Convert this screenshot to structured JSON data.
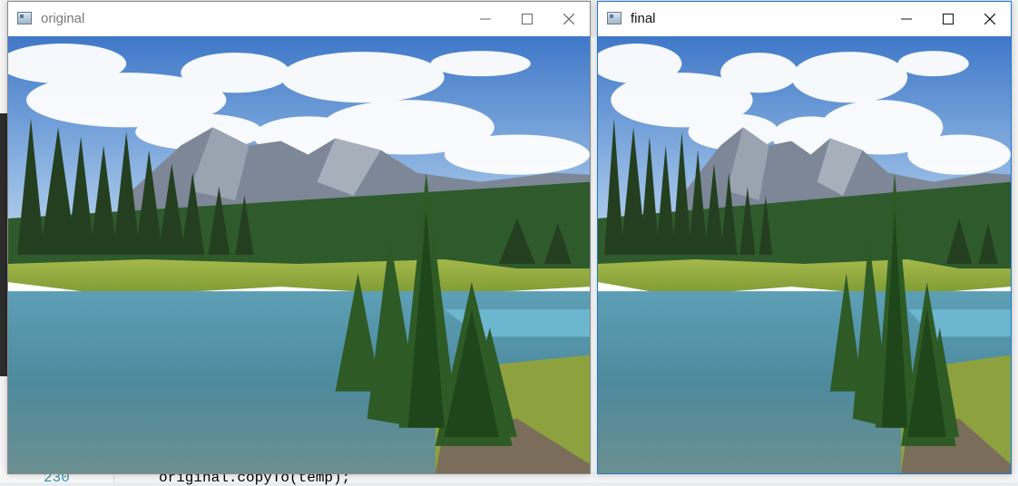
{
  "background": {
    "line_number": "230",
    "code_line": "original.copyTo(temp);"
  },
  "windows": [
    {
      "id": "original",
      "title": "original",
      "icon": "image-viewer-icon",
      "state": "inactive"
    },
    {
      "id": "final",
      "title": "final",
      "icon": "image-viewer-icon",
      "state": "active"
    }
  ],
  "window_controls": {
    "minimize": "minimize-icon",
    "maximize": "maximize-icon",
    "close": "close-icon"
  },
  "image_content": "alpine-lake-landscape"
}
